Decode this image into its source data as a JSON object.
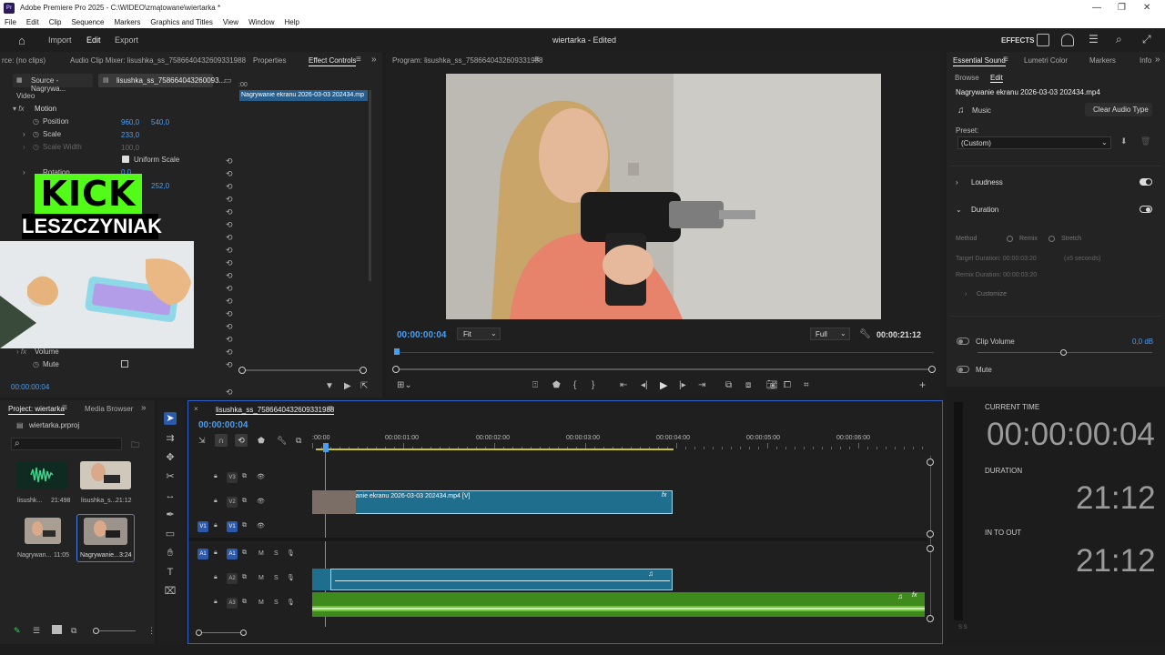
{
  "window": {
    "title": "Adobe Premiere Pro 2025 - C:\\WIDEO\\zmątowane\\wiertarka *"
  },
  "menu": [
    "File",
    "Edit",
    "Clip",
    "Sequence",
    "Markers",
    "Graphics and Titles",
    "View",
    "Window",
    "Help"
  ],
  "header": {
    "home": "Import",
    "edit": "Edit",
    "export": "Export",
    "project_title": "wiertarka - Edited",
    "effects": "EFFECTS"
  },
  "source_panel": {
    "tabs": [
      "rce: (no clips)",
      "Audio Clip Mixer: lisushka_ss_7586640432609331988",
      "Properties",
      "Effect Controls"
    ],
    "source_tab": "Source - Nagrywa...",
    "clip_tab": "lisushka_ss_758664043260093...",
    "timeline_start": ":00",
    "clip_name": "Nagrywanie ekranu 2026-03-03 202434.mp",
    "section_video": "Video",
    "motion": "Motion",
    "position_label": "Position",
    "position_x": "960,0",
    "position_y": "540,0",
    "scale_label": "Scale",
    "scale_value": "233,0",
    "scale_width_label": "Scale Width",
    "scale_width_value": "100,0",
    "uniform_scale": "Uniform Scale",
    "rotation_label": "Rotation",
    "rotation_value": "0,0",
    "anchor_value": "252,0",
    "volume": "Volume",
    "mute": "Mute",
    "timecode": "00:00:00:04"
  },
  "overlay": {
    "kick": "KICK",
    "name": "LESZCZYNIAK"
  },
  "program": {
    "title": "Program: lisushka_ss_7586640432609331988",
    "timecode": "00:00:00:04",
    "fit": "Fit",
    "quality": "Full",
    "duration": "00:00:21:12"
  },
  "essential_sound": {
    "tabs": [
      "Essential Sound",
      "Lumetri Color",
      "Markers",
      "Info"
    ],
    "browse": "Browse",
    "edit": "Edit",
    "file": "Nagrywanie ekranu 2026-03-03 202434.mp4",
    "music": "Music",
    "clear": "Clear Audio Type",
    "preset_label": "Preset:",
    "preset_value": "(Custom)",
    "loudness": "Loudness",
    "duration": "Duration",
    "method": "Method",
    "remix": "Remix",
    "stretch": "Stretch",
    "target_duration": "Target Duration: 00:00:03:20",
    "tolerance": "(±5 seconds)",
    "remix_duration": "Remix Duration: 00:00:03:20",
    "customize": "Customize",
    "clip_volume": "Clip Volume",
    "clip_volume_value": "0,0 dB",
    "mute": "Mute"
  },
  "time_display": {
    "current_label": "CURRENT TIME",
    "current": "00:00:00:04",
    "duration_label": "DURATION",
    "duration": "21:12",
    "inout_label": "IN TO OUT",
    "inout": "21:12"
  },
  "project": {
    "tabs": [
      "Project: wiertarka",
      "Media Browser"
    ],
    "file": "wiertarka.prproj",
    "items": [
      {
        "name": "lisushk...",
        "dur": "21:498"
      },
      {
        "name": "lisushka_s...",
        "dur": "21:12"
      },
      {
        "name": "Nagrywan...",
        "dur": "11:05"
      },
      {
        "name": "Nagrywanie...",
        "dur": "3:24"
      }
    ]
  },
  "timeline": {
    "tab": "lisushka_ss_7586640432609331988",
    "timecode": "00:00:00:04",
    "ruler": [
      ":00:00",
      "00:00:01:00",
      "00:00:02:00",
      "00:00:03:00",
      "00:00:04:00",
      "00:00:05:00",
      "00:00:06:00"
    ],
    "tracks": [
      "V3",
      "V2",
      "V1",
      "A1",
      "A2",
      "A3"
    ],
    "clip_v2": "Nagrywanie ekranu 2026-03-03 202434.mp4 [V]",
    "fx": "fx"
  }
}
